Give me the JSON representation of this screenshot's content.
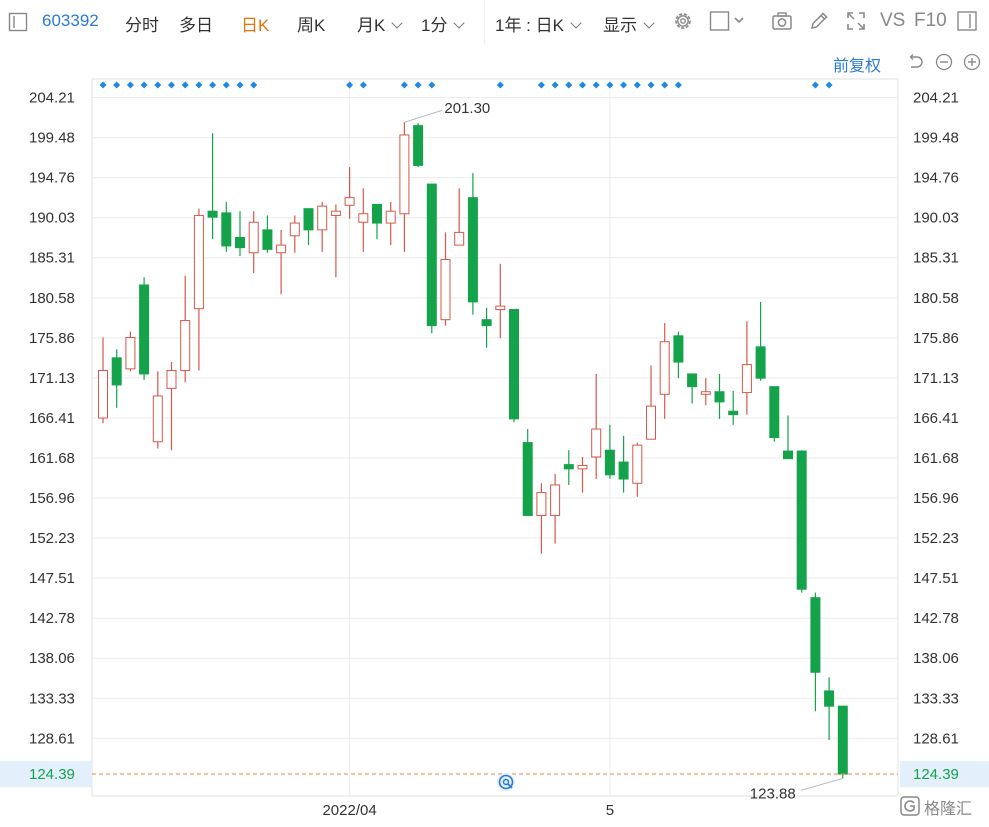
{
  "toolbar": {
    "code": "603392",
    "tabs": [
      "分时",
      "多日",
      "日K",
      "周K",
      "月K",
      "1分"
    ],
    "active_tab": "日K",
    "range": "1年 : 日K",
    "display": "显示",
    "vs_label": "VS",
    "f10_label": "F10"
  },
  "adjust_label": "前复权",
  "price_axis": [
    "204.21",
    "199.48",
    "194.76",
    "190.03",
    "185.31",
    "180.58",
    "175.86",
    "171.13",
    "166.41",
    "161.68",
    "156.96",
    "152.23",
    "147.51",
    "142.78",
    "138.06",
    "133.33",
    "128.61",
    "124.39"
  ],
  "current_price": "124.39",
  "x_labels": [
    "2022/04",
    "5"
  ],
  "annotations": {
    "high": "201.30",
    "low": "123.88"
  },
  "watermark": "格隆汇",
  "colors": {
    "up": "#d4584b",
    "down": "#14a34a",
    "grid": "#ececec",
    "price_line": "#e8843c",
    "marker": "#1e88e5",
    "axis_text": "#333333"
  },
  "chart_data": {
    "type": "candlestick",
    "title": "",
    "ylim": [
      121.8,
      206.4
    ],
    "x_ticks": [
      {
        "label": "2022/04",
        "index": 18
      },
      {
        "label": "5",
        "index": 37
      }
    ],
    "markers_at": [
      0,
      1,
      2,
      3,
      4,
      5,
      6,
      7,
      8,
      9,
      10,
      11,
      18,
      19,
      22,
      23,
      24,
      29,
      32,
      33,
      34,
      35,
      36,
      37,
      38,
      39,
      40,
      41,
      42,
      52,
      53
    ],
    "candles": [
      {
        "o": 166.4,
        "h": 175.9,
        "l": 165.8,
        "c": 172.0
      },
      {
        "o": 173.5,
        "h": 174.5,
        "l": 167.6,
        "c": 170.3
      },
      {
        "o": 172.2,
        "h": 176.6,
        "l": 171.9,
        "c": 175.9
      },
      {
        "o": 182.1,
        "h": 183.0,
        "l": 170.9,
        "c": 171.6
      },
      {
        "o": 163.6,
        "h": 171.9,
        "l": 162.8,
        "c": 169.0
      },
      {
        "o": 169.9,
        "h": 173.0,
        "l": 162.6,
        "c": 172.0
      },
      {
        "o": 172.0,
        "h": 183.2,
        "l": 170.6,
        "c": 177.9
      },
      {
        "o": 179.3,
        "h": 191.1,
        "l": 172.0,
        "c": 190.3
      },
      {
        "o": 190.8,
        "h": 200.0,
        "l": 187.5,
        "c": 190.1
      },
      {
        "o": 190.6,
        "h": 191.9,
        "l": 186.0,
        "c": 186.7
      },
      {
        "o": 187.7,
        "h": 190.8,
        "l": 185.5,
        "c": 186.5
      },
      {
        "o": 185.9,
        "h": 190.8,
        "l": 183.5,
        "c": 189.5
      },
      {
        "o": 188.6,
        "h": 190.3,
        "l": 185.9,
        "c": 186.3
      },
      {
        "o": 185.9,
        "h": 188.6,
        "l": 181.0,
        "c": 186.8
      },
      {
        "o": 187.9,
        "h": 190.3,
        "l": 185.9,
        "c": 189.4
      },
      {
        "o": 191.1,
        "h": 191.1,
        "l": 186.8,
        "c": 188.6
      },
      {
        "o": 188.6,
        "h": 191.9,
        "l": 186.0,
        "c": 191.4
      },
      {
        "o": 190.3,
        "h": 191.6,
        "l": 183.0,
        "c": 190.8
      },
      {
        "o": 191.5,
        "h": 196.0,
        "l": 189.9,
        "c": 192.4
      },
      {
        "o": 189.5,
        "h": 193.5,
        "l": 186.0,
        "c": 190.5
      },
      {
        "o": 191.6,
        "h": 191.6,
        "l": 187.5,
        "c": 189.4
      },
      {
        "o": 189.4,
        "h": 191.9,
        "l": 186.8,
        "c": 190.8
      },
      {
        "o": 190.5,
        "h": 201.3,
        "l": 186.0,
        "c": 199.8
      },
      {
        "o": 200.9,
        "h": 201.2,
        "l": 196.0,
        "c": 196.2
      },
      {
        "o": 194.0,
        "h": 194.0,
        "l": 176.4,
        "c": 177.3
      },
      {
        "o": 178.0,
        "h": 188.3,
        "l": 177.3,
        "c": 185.1
      },
      {
        "o": 186.8,
        "h": 193.5,
        "l": 186.8,
        "c": 188.3
      },
      {
        "o": 192.4,
        "h": 195.3,
        "l": 178.6,
        "c": 180.1
      },
      {
        "o": 178.0,
        "h": 179.4,
        "l": 174.7,
        "c": 177.3
      },
      {
        "o": 179.2,
        "h": 184.6,
        "l": 175.8,
        "c": 179.6
      },
      {
        "o": 179.2,
        "h": 179.2,
        "l": 165.9,
        "c": 166.3
      },
      {
        "o": 163.5,
        "h": 165.1,
        "l": 154.9,
        "c": 154.9
      },
      {
        "o": 154.9,
        "h": 158.7,
        "l": 150.4,
        "c": 157.6
      },
      {
        "o": 154.9,
        "h": 159.8,
        "l": 151.6,
        "c": 158.5
      },
      {
        "o": 160.9,
        "h": 162.6,
        "l": 158.5,
        "c": 160.4
      },
      {
        "o": 160.4,
        "h": 161.8,
        "l": 157.6,
        "c": 160.8
      },
      {
        "o": 161.8,
        "h": 171.6,
        "l": 159.2,
        "c": 165.1
      },
      {
        "o": 162.6,
        "h": 165.6,
        "l": 159.2,
        "c": 159.7
      },
      {
        "o": 161.2,
        "h": 164.3,
        "l": 157.6,
        "c": 159.2
      },
      {
        "o": 158.7,
        "h": 163.5,
        "l": 157.1,
        "c": 163.2
      },
      {
        "o": 163.9,
        "h": 172.6,
        "l": 163.9,
        "c": 167.8
      },
      {
        "o": 169.2,
        "h": 177.6,
        "l": 166.3,
        "c": 175.4
      },
      {
        "o": 176.1,
        "h": 176.6,
        "l": 171.1,
        "c": 173.0
      },
      {
        "o": 171.6,
        "h": 171.6,
        "l": 168.1,
        "c": 170.1
      },
      {
        "o": 169.2,
        "h": 171.1,
        "l": 167.9,
        "c": 169.5
      },
      {
        "o": 169.5,
        "h": 171.6,
        "l": 166.3,
        "c": 168.3
      },
      {
        "o": 167.2,
        "h": 169.6,
        "l": 165.6,
        "c": 166.8
      },
      {
        "o": 169.4,
        "h": 177.8,
        "l": 166.8,
        "c": 172.7
      },
      {
        "o": 174.8,
        "h": 180.1,
        "l": 170.8,
        "c": 171.1
      },
      {
        "o": 170.1,
        "h": 170.1,
        "l": 163.6,
        "c": 164.1
      },
      {
        "o": 162.5,
        "h": 166.7,
        "l": 162.1,
        "c": 161.6
      },
      {
        "o": 162.5,
        "h": 162.6,
        "l": 145.8,
        "c": 146.2
      },
      {
        "o": 145.2,
        "h": 145.8,
        "l": 131.8,
        "c": 136.4
      },
      {
        "o": 134.2,
        "h": 135.8,
        "l": 128.4,
        "c": 132.4
      },
      {
        "o": 132.4,
        "h": 132.4,
        "l": 123.88,
        "c": 124.39
      }
    ]
  }
}
